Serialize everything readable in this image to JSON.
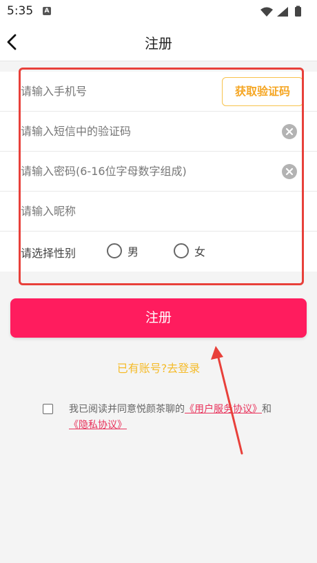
{
  "status": {
    "time": "5:35",
    "notification_icon_letter": "A"
  },
  "header": {
    "title": "注册",
    "back_icon": "chevron-left-icon"
  },
  "form": {
    "phone_placeholder": "请输入手机号",
    "get_code_label": "获取验证码",
    "code_placeholder": "请输入短信中的验证码",
    "password_placeholder": "请输入密码(6-16位字母数字组成)",
    "nickname_placeholder": "请输入昵称",
    "gender_label": "请选择性别",
    "gender_options": [
      "男",
      "女"
    ],
    "clear_icon": "clear-circle-icon"
  },
  "actions": {
    "register_label": "注册",
    "login_link": "已有账号?去登录"
  },
  "agreement": {
    "prefix": "我已阅读并同意悦颜茶聊的",
    "user_agreement": "《用户服务协议》",
    "conjunction": "和",
    "privacy_policy": "《隐私协议》"
  },
  "colors": {
    "primary": "#ff1c5e",
    "accent_yellow": "#f5a623",
    "annotation_red": "#e8403a",
    "link": "#e8315a"
  }
}
